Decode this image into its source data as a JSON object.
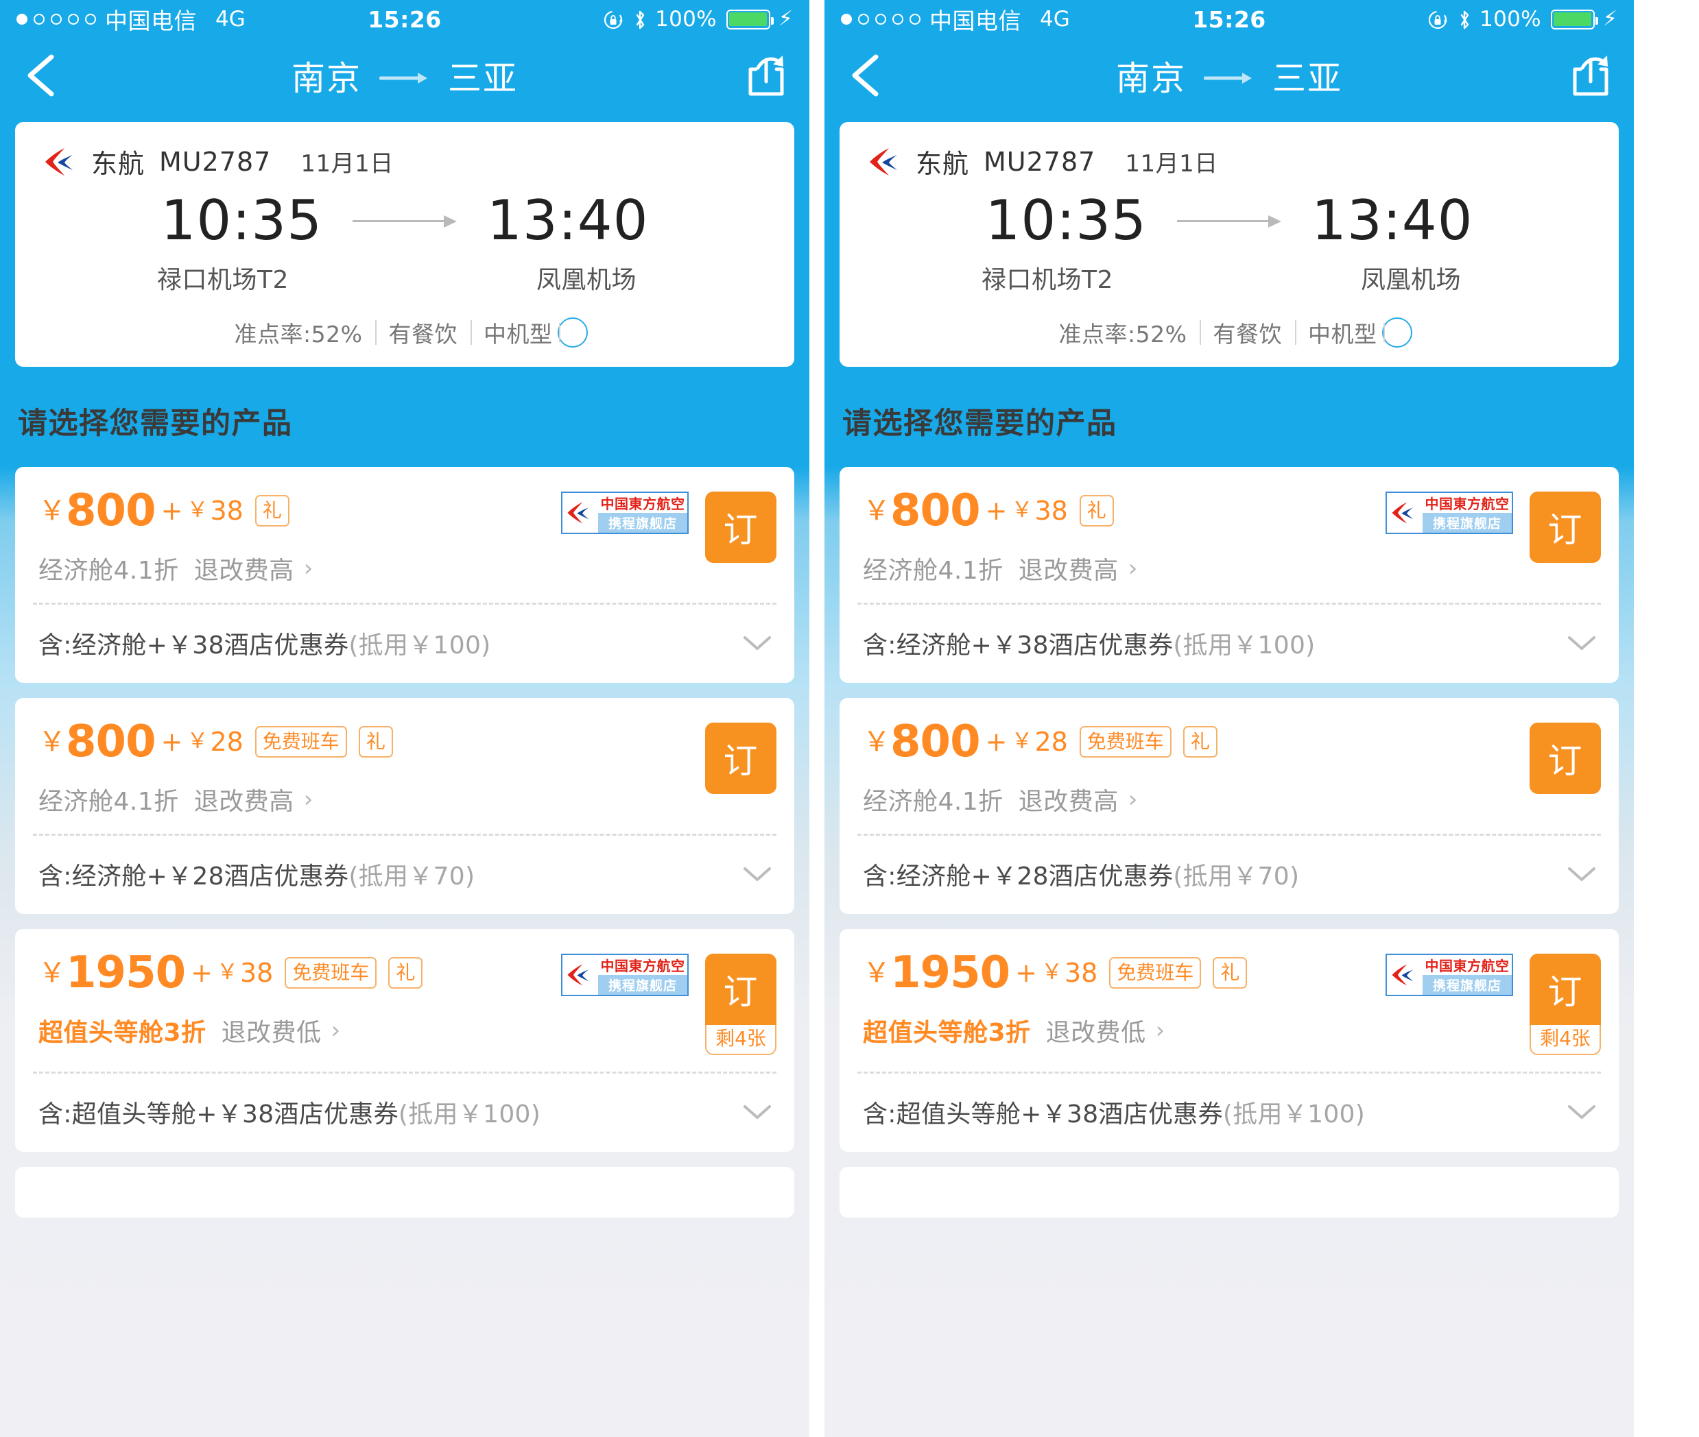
{
  "status_bar": {
    "signal_dots": 5,
    "signal_filled": 1,
    "carrier": "中国电信",
    "network": "4G",
    "time": "15:26",
    "battery_percent": "100%",
    "icons": [
      "rotation-lock-icon",
      "bluetooth-icon",
      "battery-icon",
      "charging-bolt-icon"
    ],
    "accent": "#17A9E8"
  },
  "nav": {
    "back_icon": "chevron-left-icon",
    "origin": "南京",
    "arrow": "→",
    "destination": "三亚",
    "share_icon": "share-icon"
  },
  "flight": {
    "airline": "东航",
    "flight_no": "MU2787",
    "date": "11月1日",
    "depart_time": "10:35",
    "arrive_time": "13:40",
    "depart_airport": "禄口机场T2",
    "arrive_airport": "凤凰机场",
    "meta": [
      "准点率:52%",
      "有餐饮",
      "中机型"
    ],
    "detail_arrow_icon": "circle-chevron-right-icon"
  },
  "section": {
    "title": "请选择您需要的产品"
  },
  "airline_badge": {
    "line1": "中国東方航空",
    "line2": "携程旗舰店",
    "line1_color": "#E2231A",
    "border_color": "#3E8FD8"
  },
  "products": [
    {
      "currency": "￥",
      "price": "800",
      "plus": "+",
      "addon_currency": "￥",
      "addon": "38",
      "tags": [
        "礼"
      ],
      "show_airline_badge": true,
      "cabin": "经济舱4.1折",
      "cabin_highlight": false,
      "rule": "退改费高",
      "order_label": "订",
      "order_sub": "",
      "include_prefix": "含:经济舱+￥38酒店优惠券",
      "include_suffix": "(抵用￥100)",
      "expand_icon": "chevron-down-icon"
    },
    {
      "currency": "￥",
      "price": "800",
      "plus": "+",
      "addon_currency": "￥",
      "addon": "28",
      "tags": [
        "免费班车",
        "礼"
      ],
      "show_airline_badge": false,
      "cabin": "经济舱4.1折",
      "cabin_highlight": false,
      "rule": "退改费高",
      "order_label": "订",
      "order_sub": "",
      "include_prefix": "含:经济舱+￥28酒店优惠券",
      "include_suffix": "(抵用￥70)",
      "expand_icon": "chevron-down-icon"
    },
    {
      "currency": "￥",
      "price": "1950",
      "plus": "+",
      "addon_currency": "￥",
      "addon": "38",
      "tags": [
        "免费班车",
        "礼"
      ],
      "show_airline_badge": true,
      "cabin": "超值头等舱3折",
      "cabin_highlight": true,
      "rule": "退改费低",
      "order_label": "订",
      "order_sub": "剩4张",
      "include_prefix": "含:超值头等舱+￥38酒店优惠券",
      "include_suffix": "(抵用￥100)",
      "expand_icon": "chevron-down-icon"
    }
  ],
  "colors": {
    "brand_blue": "#17A9E8",
    "accent_orange": "#FF8A24",
    "button_orange": "#F79120",
    "card_white": "#FFFFFF",
    "page_grey": "#EFEFF4"
  }
}
